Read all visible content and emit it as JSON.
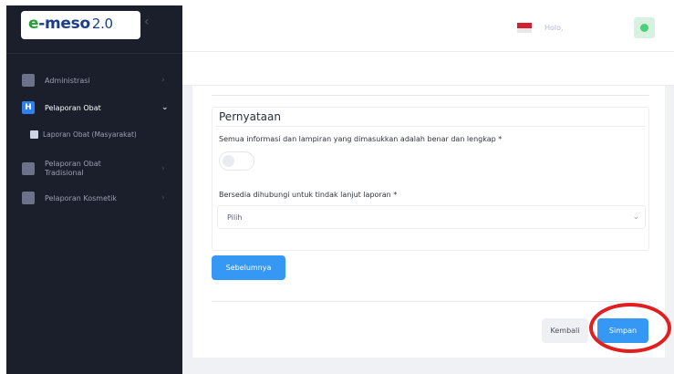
{
  "sidebar": {
    "logo": {
      "prefix": "e",
      "name": "-meso",
      "version": "2.0"
    },
    "collapse_glyph": "‹",
    "items": [
      {
        "label": "Administrasi",
        "icon": "folder-icon",
        "chevron": "›"
      },
      {
        "label": "Pelaporan Obat",
        "icon": "h-square-icon",
        "chevron": "⌄",
        "active": true
      },
      {
        "label": "Laporan Obat (Masyarakat)",
        "icon": "document-icon",
        "sub": true
      },
      {
        "label_line1": "Pelaporan Obat",
        "label_line2": "Tradisional",
        "icon": "herbal-icon",
        "chevron": "›"
      },
      {
        "label": "Pelaporan Kosmetik",
        "icon": "cosmetic-icon",
        "chevron": "›"
      }
    ]
  },
  "header": {
    "language_flag": "indonesia-flag-icon",
    "greeting": "Holo,",
    "avatar": "user-avatar"
  },
  "form": {
    "section_title": "Pernyataan",
    "statement_label": "Semua informasi dan lampiran yang dimasukkan adalah benar dan lengkap *",
    "statement_toggle_on": false,
    "contact_label": "Bersedia dihubungi untuk tindak lanjut laporan *",
    "contact_select_value": "Pilih",
    "chevron": "⌄"
  },
  "buttons": {
    "previous": "Sebelumnya",
    "back": "Kembali",
    "save": "Simpan"
  },
  "colors": {
    "sidebar_bg": "#1b1e2b",
    "primary": "#3598f5",
    "highlight": "#e02020"
  }
}
